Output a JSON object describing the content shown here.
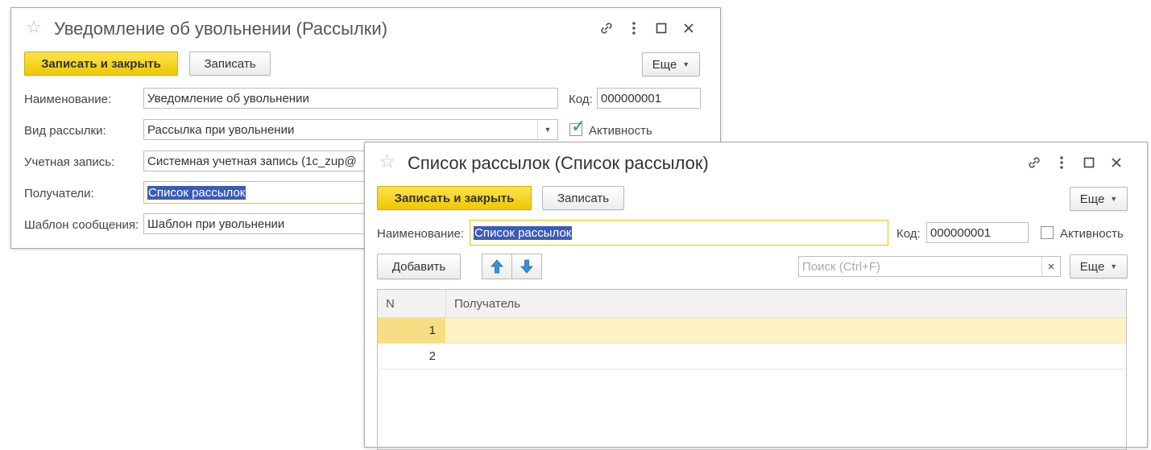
{
  "window1": {
    "title": "Уведомление об увольнении (Рассылки)",
    "save_close_label": "Записать и закрыть",
    "save_label": "Записать",
    "more_label": "Еще",
    "name_label": "Наименование:",
    "name_value": "Уведомление об увольнении",
    "code_label": "Код:",
    "code_value": "000000001",
    "type_label": "Вид рассылки:",
    "type_value": "Рассылка при увольнении",
    "active_label": "Активность",
    "active_checked": true,
    "account_label": "Учетная запись:",
    "account_value": "Системная учетная запись (1c_zup@",
    "recipients_label": "Получатели:",
    "recipients_value": "Список рассылок",
    "template_label": "Шаблон сообщения:",
    "template_value": "Шаблон при увольнении"
  },
  "window2": {
    "title": "Список рассылок (Список рассылок)",
    "save_close_label": "Записать и закрыть",
    "save_label": "Записать",
    "more_label": "Еще",
    "name_label": "Наименование:",
    "name_value": "Список рассылок",
    "code_label": "Код:",
    "code_value": "000000001",
    "active_label": "Активность",
    "active_checked": false,
    "add_label": "Добавить",
    "search_placeholder": "Поиск (Ctrl+F)",
    "more2_label": "Еще",
    "table": {
      "columns": [
        "N",
        "Получатель"
      ],
      "rows": [
        {
          "n": "1",
          "recipient": ""
        },
        {
          "n": "2",
          "recipient": ""
        }
      ]
    }
  },
  "icons": {
    "star": "star-icon",
    "link": "link-icon",
    "menu": "kebab-menu-icon",
    "maximize": "maximize-icon",
    "close": "close-icon",
    "up": "arrow-up-icon",
    "down": "arrow-down-icon"
  },
  "colors": {
    "primary_button": "#f5d000",
    "selection": "#3c5bb6",
    "focus_border": "#f3c300",
    "selected_row": "#fdf2c4",
    "checkmark": "#2ea043",
    "arrow_icon": "#3a8fd6"
  }
}
